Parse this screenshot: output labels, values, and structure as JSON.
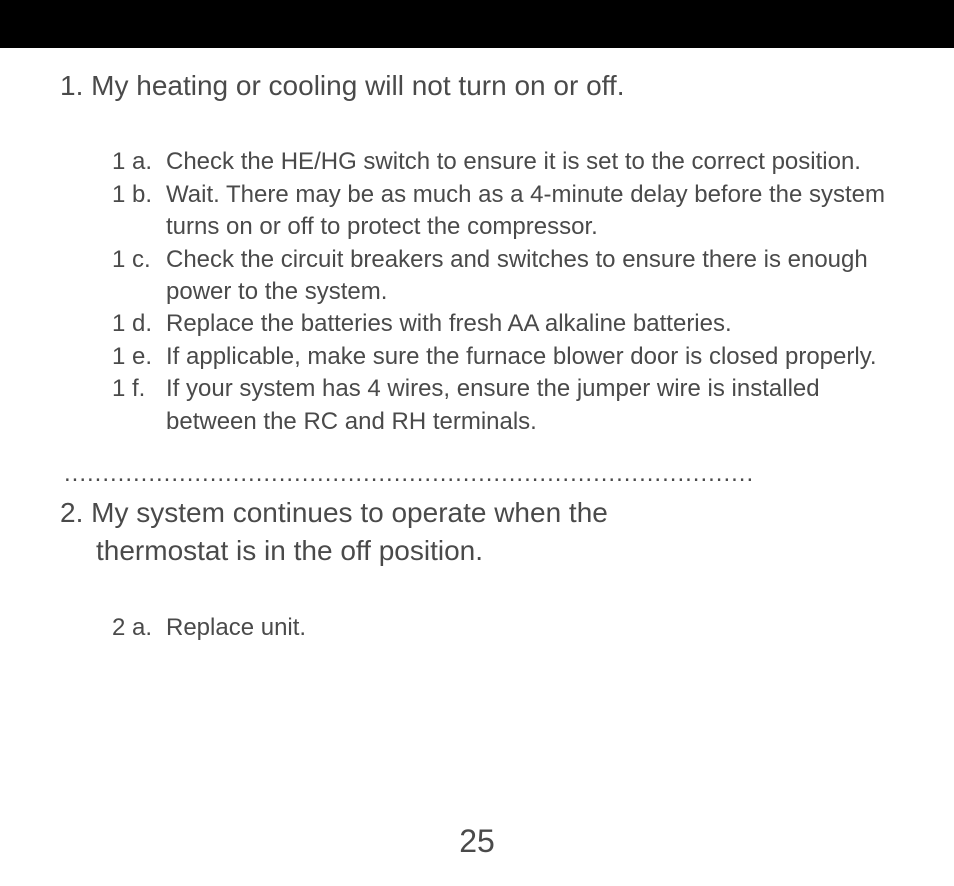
{
  "section1": {
    "number": "1.",
    "title": "My heating or cooling will not turn on or off.",
    "items": [
      {
        "label": "1 a.",
        "text": "Check the HE/HG switch to ensure it is set to the correct position."
      },
      {
        "label": "1 b.",
        "text": "Wait. There may be as much as a 4-minute delay before the system turns on or off to protect the compressor."
      },
      {
        "label": "1 c.",
        "text": "Check the circuit breakers and switches to ensure there is enough power to the system."
      },
      {
        "label": "1 d.",
        "text": "Replace the batteries with fresh AA alkaline batteries."
      },
      {
        "label": "1 e.",
        "text": "If applicable, make sure the furnace blower door is closed properly."
      },
      {
        "label": "1 f.",
        "text": "If your system has 4 wires, ensure the jumper wire is installed between the RC and RH terminals."
      }
    ]
  },
  "divider": "..........................................................................................",
  "section2": {
    "number": "2.",
    "title_line1": "My system continues to operate when the",
    "title_line2": "thermostat is in the off position.",
    "items": [
      {
        "label": "2 a.",
        "text": "Replace unit."
      }
    ]
  },
  "page_number": "25"
}
